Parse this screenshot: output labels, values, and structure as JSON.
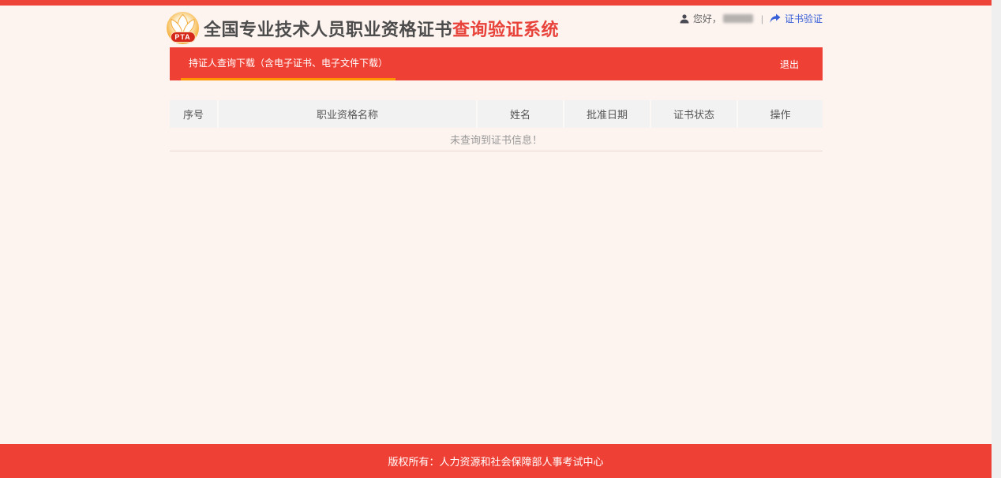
{
  "header": {
    "logo_text": "PTA",
    "title_main": "全国专业技术人员职业资格证书",
    "title_accent": "查询验证系统",
    "user": {
      "greeting": "您好，",
      "separator": "|",
      "verify_link": "证书验证"
    }
  },
  "nav": {
    "active_tab": "持证人查询下载（含电子证书、电子文件下载）",
    "logout_label": "退出"
  },
  "table": {
    "headers": [
      "序号",
      "职业资格名称",
      "姓名",
      "批准日期",
      "证书状态",
      "操作"
    ],
    "empty_message": "未查询到证书信息！"
  },
  "footer": {
    "copyright": "版权所有：人力资源和社会保障部人事考试中心"
  },
  "icons": {
    "user": "user-icon",
    "share_arrow": "share-arrow-icon"
  },
  "colors": {
    "top_bar_red": "#ee4338",
    "primary_red": "#ee4035",
    "accent_orange": "#ff9502",
    "page_background": "#fdf3ef",
    "title_gray": "#4c4c4c",
    "title_red": "#e8433a",
    "link_blue": "#3860d8",
    "table_header_bg": "#f2f2f2"
  }
}
